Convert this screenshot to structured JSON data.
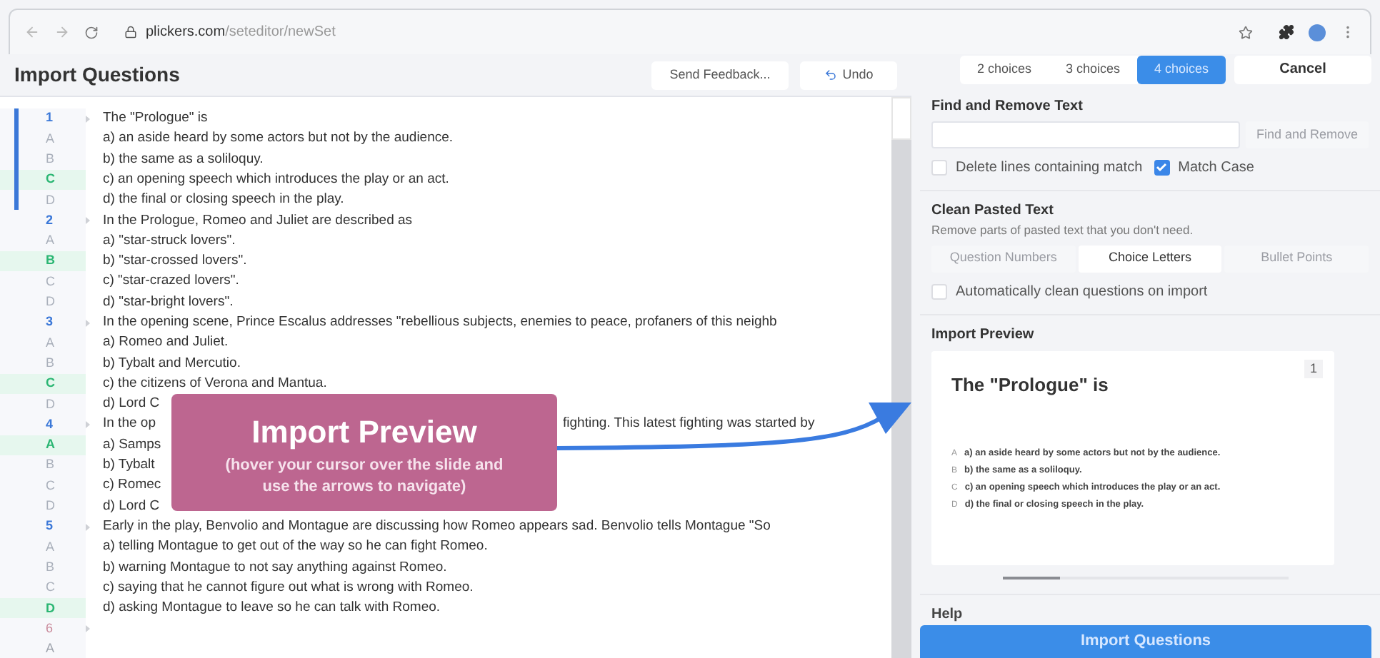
{
  "browser": {
    "url_domain": "plickers.com",
    "url_path": "/seteditor/newSet"
  },
  "header": {
    "title": "Import Questions",
    "buttons": [
      {
        "label": "Send Feedback..."
      },
      {
        "label": "Undo"
      }
    ]
  },
  "choice_tabs": [
    {
      "label": "2 choices",
      "selected": false
    },
    {
      "label": "3 choices",
      "selected": false
    },
    {
      "label": "4 choices",
      "selected": true
    }
  ],
  "cancel_button": "Cancel",
  "editor": {
    "lines": [
      {
        "label": "1",
        "kind": "question",
        "current": true,
        "text": "The \"Prologue\" is"
      },
      {
        "label": "A",
        "kind": "choice",
        "current": true,
        "correct": false,
        "text": "a) an aside heard by some actors but not by the audience."
      },
      {
        "label": "B",
        "kind": "choice",
        "current": true,
        "correct": false,
        "text": "b) the same as a soliloquy."
      },
      {
        "label": "C",
        "kind": "choice",
        "current": true,
        "correct": true,
        "text": "c) an opening speech which introduces the play or an act."
      },
      {
        "label": "D",
        "kind": "choice",
        "current": true,
        "correct": false,
        "text": "d) the final or closing speech in the play."
      },
      {
        "label": "2",
        "kind": "question",
        "current": false,
        "text": "In the Prologue, Romeo and Juliet are described as"
      },
      {
        "label": "A",
        "kind": "choice",
        "current": false,
        "correct": false,
        "text": "a) \"star-struck lovers\"."
      },
      {
        "label": "B",
        "kind": "choice",
        "current": false,
        "correct": true,
        "text": "b) \"star-crossed lovers\"."
      },
      {
        "label": "C",
        "kind": "choice",
        "current": false,
        "correct": false,
        "text": "c) \"star-crazed lovers\"."
      },
      {
        "label": "D",
        "kind": "choice",
        "current": false,
        "correct": false,
        "text": "d) \"star-bright lovers\"."
      },
      {
        "label": "3",
        "kind": "question",
        "current": false,
        "text": "In the opening scene, Prince Escalus addresses \"rebellious subjects, enemies to peace, profaners of this neighb"
      },
      {
        "label": "A",
        "kind": "choice",
        "current": false,
        "correct": false,
        "text": "a) Romeo and Juliet."
      },
      {
        "label": "B",
        "kind": "choice",
        "current": false,
        "correct": false,
        "text": "b) Tybalt and Mercutio."
      },
      {
        "label": "C",
        "kind": "choice",
        "current": false,
        "correct": true,
        "text": "c) the citizens of Verona and Mantua."
      },
      {
        "label": "D",
        "kind": "choice",
        "current": false,
        "correct": false,
        "text": "d) Lord C"
      },
      {
        "label": "4",
        "kind": "question",
        "current": false,
        "text": "In the op",
        "tail": "fighting. This latest fighting was started by"
      },
      {
        "label": "A",
        "kind": "choice",
        "current": false,
        "correct": true,
        "text": "a) Samps"
      },
      {
        "label": "B",
        "kind": "choice",
        "current": false,
        "correct": false,
        "text": "b) Tybalt"
      },
      {
        "label": "C",
        "kind": "choice",
        "current": false,
        "correct": false,
        "text": "c) Romec"
      },
      {
        "label": "D",
        "kind": "choice",
        "current": false,
        "correct": false,
        "text": "d) Lord C"
      },
      {
        "label": "5",
        "kind": "question",
        "current": false,
        "text": "Early in the play, Benvolio and Montague are discussing how Romeo appears sad. Benvolio tells Montague \"So"
      },
      {
        "label": "A",
        "kind": "choice",
        "current": false,
        "correct": false,
        "text": "a) telling Montague to get out of the way so he can fight Romeo."
      },
      {
        "label": "B",
        "kind": "choice",
        "current": false,
        "correct": false,
        "text": "b) warning Montague to not say anything against Romeo."
      },
      {
        "label": "C",
        "kind": "choice",
        "current": false,
        "correct": false,
        "text": "c) saying that he cannot figure out what is wrong with Romeo."
      },
      {
        "label": "D",
        "kind": "choice",
        "current": false,
        "correct": true,
        "text": "d) asking Montague to leave so he can talk with Romeo."
      },
      {
        "label": "6",
        "kind": "empty"
      },
      {
        "label": "A",
        "kind": "empty"
      }
    ]
  },
  "callout": {
    "title": "Import Preview",
    "text": "(hover your cursor over the slide and use the arrows to navigate)"
  },
  "find_remove": {
    "heading": "Find and Remove Text",
    "button": {
      "label": "Find and Remove",
      "disabled": true
    },
    "options": [
      {
        "label": "Delete lines containing match",
        "checked": false
      },
      {
        "label": "Match Case",
        "checked": true
      }
    ]
  },
  "clean": {
    "heading": "Clean Pasted Text",
    "subtitle": "Remove parts of pasted text that you don't need.",
    "buttons": [
      {
        "label": "Question Numbers",
        "disabled": true
      },
      {
        "label": "Choice Letters",
        "disabled": false
      },
      {
        "label": "Bullet Points",
        "disabled": true
      }
    ],
    "option": {
      "label": "Automatically clean questions on import",
      "checked": false
    }
  },
  "preview": {
    "heading": "Import Preview",
    "slide": {
      "question": "The \"Prologue\" is",
      "number": "1",
      "choices": [
        {
          "letter": "A",
          "text": "a) an aside heard by some actors but not by the audience."
        },
        {
          "letter": "B",
          "text": "b) the same as a soliloquy."
        },
        {
          "letter": "C",
          "text": "c) an opening speech which introduces the play or an act."
        },
        {
          "letter": "D",
          "text": "d) the final or closing speech in the play."
        }
      ]
    }
  },
  "help": "Help",
  "import_button": "Import Questions"
}
